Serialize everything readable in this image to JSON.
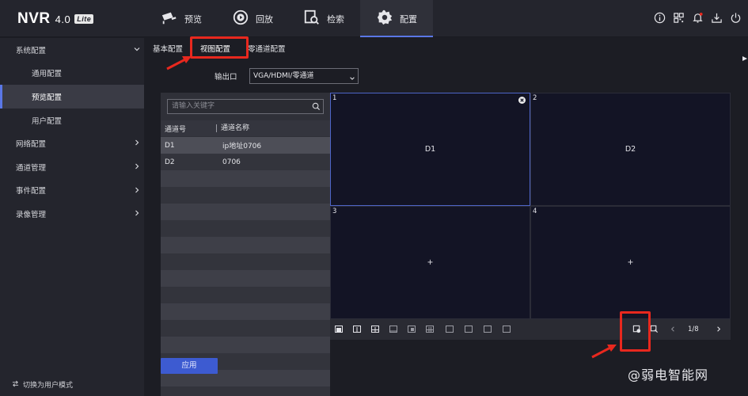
{
  "brand": {
    "name": "NVR",
    "version": "4.0",
    "edition": "Lite"
  },
  "nav": [
    {
      "label": "预览",
      "icon": "camera-icon"
    },
    {
      "label": "回放",
      "icon": "playback-icon"
    },
    {
      "label": "检索",
      "icon": "search-doc-icon"
    },
    {
      "label": "配置",
      "icon": "gear-icon",
      "active": true
    }
  ],
  "top_icons": [
    "info-icon",
    "qr-code-icon",
    "bell-icon",
    "download-icon",
    "power-icon"
  ],
  "sidebar": {
    "items": [
      {
        "label": "系统配置",
        "expanded": true
      },
      {
        "label": "通用配置",
        "sub": true
      },
      {
        "label": "预览配置",
        "sub": true,
        "active": true
      },
      {
        "label": "用户配置",
        "sub": true
      },
      {
        "label": "网络配置"
      },
      {
        "label": "通道管理"
      },
      {
        "label": "事件配置"
      },
      {
        "label": "录像管理"
      }
    ],
    "footer": "切换为用户模式"
  },
  "tabs": [
    {
      "label": "基本配置"
    },
    {
      "label": "视图配置",
      "active": true
    },
    {
      "label": "零通道配置"
    }
  ],
  "output": {
    "label": "输出口",
    "value": "VGA/HDMI/零通道"
  },
  "search": {
    "placeholder": "请输入关键字"
  },
  "channel_table": {
    "headers": [
      "通道号",
      "通道名称"
    ],
    "rows": [
      {
        "id": "D1",
        "name": "ip地址0706"
      },
      {
        "id": "D2",
        "name": "0706"
      }
    ]
  },
  "preview": {
    "cells": [
      {
        "num": "1",
        "label": "D1"
      },
      {
        "num": "2",
        "label": "D2"
      },
      {
        "num": "3",
        "label": "+"
      },
      {
        "num": "4",
        "label": "+"
      }
    ],
    "page": "1/8"
  },
  "apply_label": "应用",
  "watermark": "@弱电智能网",
  "colors": {
    "accent": "#3d5bd1",
    "highlight": "#e8281e",
    "background": "#1c1d24"
  }
}
